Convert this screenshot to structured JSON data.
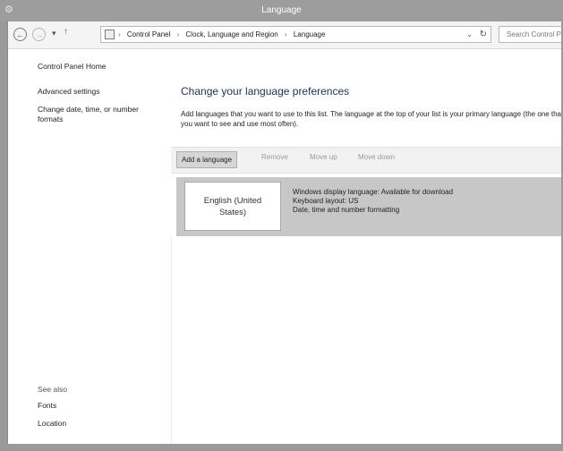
{
  "window": {
    "title": "Language"
  },
  "nav": {
    "back_icon": "back-arrow-icon",
    "forward_icon": "forward-arrow-icon",
    "recent_icon": "chevron-down-icon",
    "up_icon": "up-arrow-icon",
    "breadcrumbs": [
      "Control Panel",
      "Clock, Language and Region",
      "Language"
    ],
    "search_placeholder": "Search Control Panel"
  },
  "sidebar": {
    "items": [
      {
        "label": "Control Panel Home"
      },
      {
        "label": "Advanced settings"
      },
      {
        "label": "Change date, time, or number formats"
      }
    ],
    "see_also_heading": "See also",
    "see_also": [
      {
        "label": "Fonts"
      },
      {
        "label": "Location"
      }
    ]
  },
  "main": {
    "heading": "Change your language preferences",
    "description": "Add languages that you want to use to this list. The language at the top of your list is your primary language (the one that you want to see and use most often).",
    "toolbar": {
      "add": "Add a language",
      "remove": "Remove",
      "move_up": "Move up",
      "move_down": "Move down"
    },
    "languages": [
      {
        "name": "English (United States)",
        "details": [
          "Windows display language: Available for download",
          "Keyboard layout: US",
          "Date, time and number formatting"
        ]
      }
    ]
  }
}
